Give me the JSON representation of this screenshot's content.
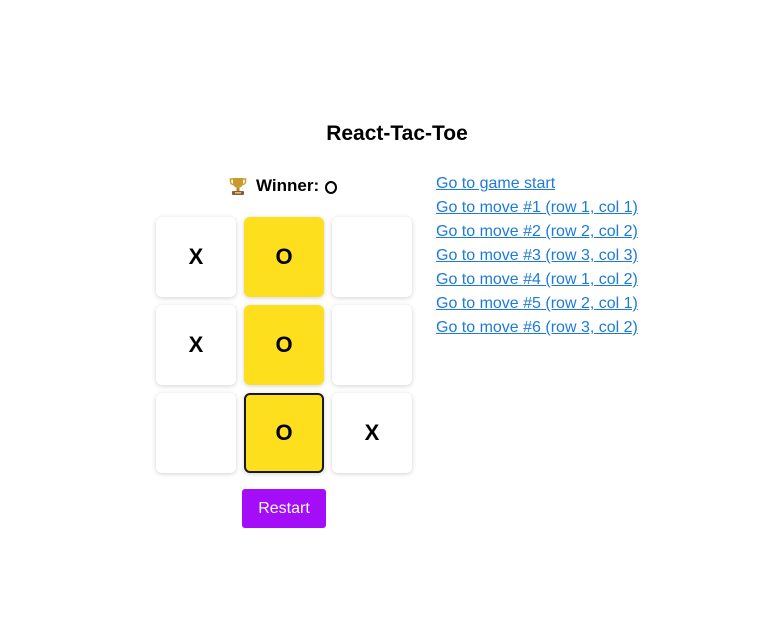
{
  "title": "React-Tac-Toe",
  "status": {
    "icon": "trophy-icon",
    "label": "Winner:",
    "winner": "O"
  },
  "board": [
    [
      "X",
      "O",
      ""
    ],
    [
      "X",
      "O",
      ""
    ],
    [
      "",
      "O",
      "X"
    ]
  ],
  "winning_line": [
    [
      0,
      1
    ],
    [
      1,
      1
    ],
    [
      2,
      1
    ]
  ],
  "focused_cell": [
    2,
    1
  ],
  "restart_label": "Restart",
  "history": [
    "Go to game start",
    "Go to move #1 (row 1, col 1)",
    "Go to move #2 (row 2, col 2)",
    "Go to move #3 (row 3, col 3)",
    "Go to move #4 (row 1, col 2)",
    "Go to move #5 (row 2, col 1)",
    "Go to move #6 (row 3, col 2)"
  ],
  "colors": {
    "win_cell": "#fddf1e",
    "restart_button": "#a30df7",
    "link": "#1c7bd9"
  }
}
